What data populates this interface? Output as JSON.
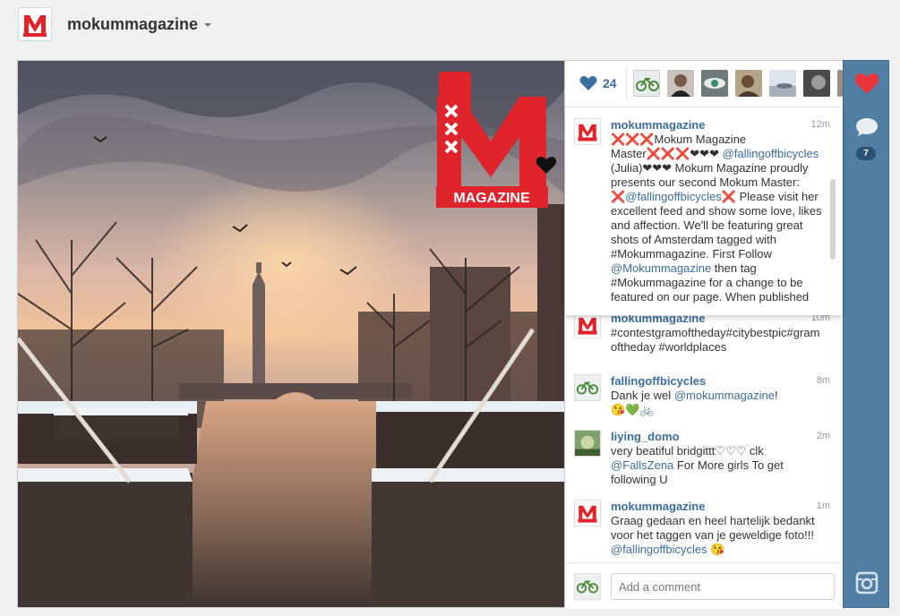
{
  "header": {
    "username": "mokummagazine"
  },
  "photo": {
    "overlay_logo_letter": "M",
    "overlay_logo_word": "MAGAZINE",
    "overlay_logo_script": "master"
  },
  "likes": {
    "count": "24"
  },
  "caption": {
    "user": "mokummagazine",
    "time": "12m",
    "text_1": "❌❌❌Mokum Magazine Master❌❌❌❤❤❤ ",
    "mention_1": "@fallingoffbicycles",
    "text_2": " (Julia)❤❤❤ Mokum Magazine proudly presents our second Mokum Master: ❌",
    "mention_2": "@fallingoffbicycles",
    "text_3": "❌ Please visit her excellent feed and show some love, likes and affection. We'll be featuring great shots of Amsterdam tagged with #Mokummagazine. First Follow ",
    "mention_3": "@Mokummagazine",
    "text_4": " then tag #Mokummagazine for a change to be featured on our page. When published"
  },
  "comments": [
    {
      "user": "mokummagazine",
      "time": "10m",
      "text": "#contestgramoftheday#citybestpic#gramoftheday #worldplaces"
    },
    {
      "user": "fallingoffbicycles",
      "time": "8m",
      "text_before": "Dank je wel ",
      "mention": "@mokummagazine",
      "text_after": "!\n😘💚🚲"
    },
    {
      "user": "liying_domo",
      "time": "2m",
      "text_before": "very beatiful bridgittt♡♡♡ clk\n",
      "mention": "@FallsZena",
      "text_after": " For More girls To get following U"
    },
    {
      "user": "mokummagazine",
      "time": "1m",
      "text_before": "Graag gedaan en heel hartelijk bedankt voor het taggen van je geweldige foto!!! ",
      "mention": "@fallingoffbicycles",
      "text_after": " 😘"
    }
  ],
  "add_comment": {
    "placeholder": "Add a comment"
  },
  "actions": {
    "comment_count": "7"
  },
  "colors": {
    "link": "#3b6d9e",
    "action_bar": "#517fa4",
    "like_heart": "#e8363c",
    "logo_red": "#e0242b"
  }
}
